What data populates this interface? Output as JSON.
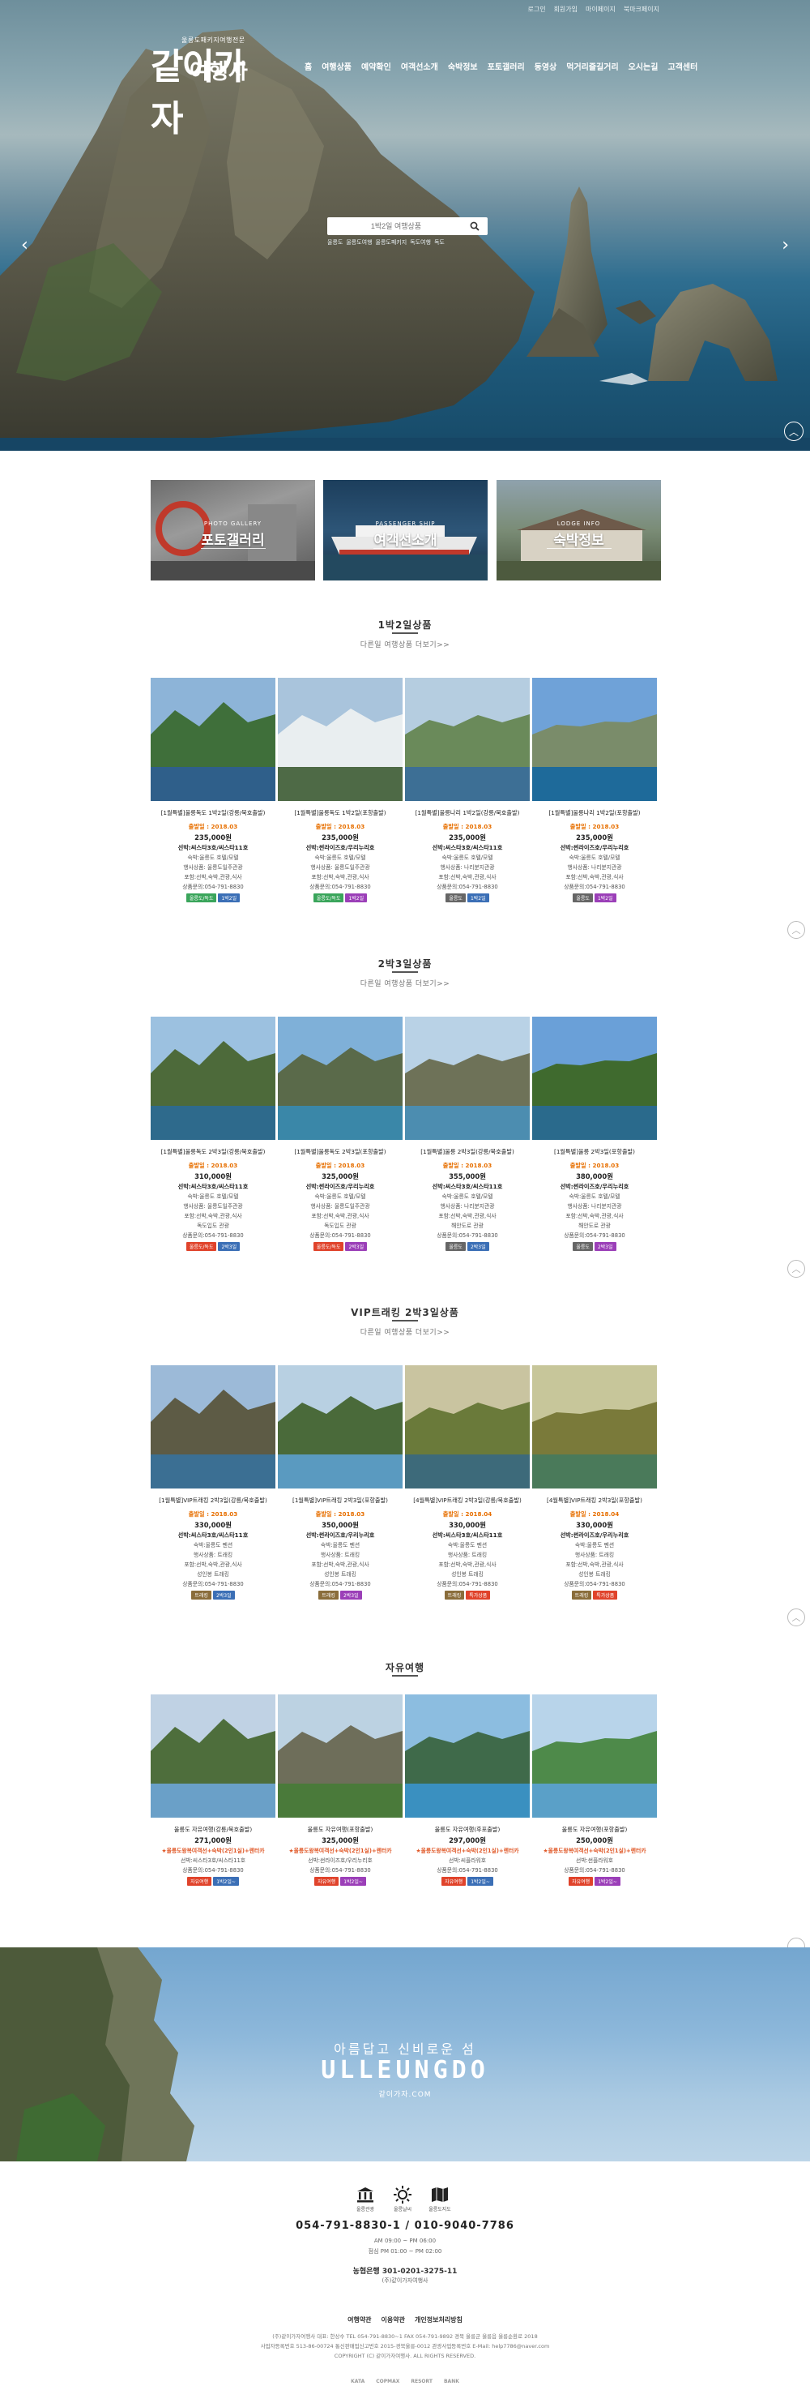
{
  "topbar": [
    "로그인",
    "회원가입",
    "마이페이지",
    "북마크페이지"
  ],
  "logo": {
    "sub": "울릉도패키지여행전문",
    "line1": "같이가자",
    "line2": "여행사"
  },
  "nav": [
    "홈",
    "여행상품",
    "예약확인",
    "여객선소개",
    "숙박정보",
    "포토갤러리",
    "동영상",
    "먹거리즐길거리",
    "오시는길",
    "고객센터"
  ],
  "search": {
    "placeholder": "1박2일 여행상품",
    "keywords": [
      "울릉도",
      "울릉도여행",
      "울릉도패키지",
      "독도여행",
      "독도"
    ]
  },
  "quick": [
    {
      "small": "PHOTO GALLERY",
      "label": "포토갤러리"
    },
    {
      "small": "PASSENGER SHIP",
      "label": "여객선소개"
    },
    {
      "small": "LODGE INFO",
      "label": "숙박정보"
    }
  ],
  "sections": [
    {
      "title": "1박2일상품",
      "more": "다른일 여행상품 더보기>>",
      "cards": [
        {
          "title": "[1월특별]울릉독도 1박2일(강릉/묵호출발)",
          "date": "출발일 : 2018.03",
          "price": "235,000원",
          "lines": [
            "선박:씨스타3호/씨스타11호",
            "숙박:울릉도 호텔/모텔",
            "행사상품: 울릉도일주관광",
            "포함:선박,숙박,관광,식사",
            "상품문의:054-791-8830"
          ],
          "tags": [
            {
              "t": "울릉도/독도",
              "c": "#3aa55b"
            },
            {
              "t": "1박2일",
              "c": "#3b6fb6"
            }
          ]
        },
        {
          "title": "[1월특별]울릉독도 1박2일(포항출발)",
          "date": "출발일 : 2018.03",
          "price": "235,000원",
          "lines": [
            "선박:썬라이즈호/우리누리호",
            "숙박:울릉도 호텔/모텔",
            "행사상품: 울릉도일주관광",
            "포함:선박,숙박,관광,식사",
            "상품문의:054-791-8830"
          ],
          "tags": [
            {
              "t": "울릉도/독도",
              "c": "#3aa55b"
            },
            {
              "t": "1박2일",
              "c": "#9b3fb8"
            }
          ]
        },
        {
          "title": "[1월특별]울릉나리 1박2일(강릉/묵호출발)",
          "date": "출발일 : 2018.03",
          "price": "235,000원",
          "lines": [
            "선박:씨스타3호/씨스타11호",
            "숙박:울릉도 호텔/모텔",
            "행사상품: 나리분지관광",
            "포함:선박,숙박,관광,식사",
            "상품문의:054-791-8830"
          ],
          "tags": [
            {
              "t": "울릉도",
              "c": "#666666"
            },
            {
              "t": "1박2일",
              "c": "#3b6fb6"
            }
          ]
        },
        {
          "title": "[1월특별]울릉나리 1박2일(포항출발)",
          "date": "출발일 : 2018.03",
          "price": "235,000원",
          "lines": [
            "선박:썬라이즈호/우리누리호",
            "숙박:울릉도 호텔/모텔",
            "행사상품: 나리분지관광",
            "포함:선박,숙박,관광,식사",
            "상품문의:054-791-8830"
          ],
          "tags": [
            {
              "t": "울릉도",
              "c": "#666666"
            },
            {
              "t": "1박2일",
              "c": "#9b3fb8"
            }
          ]
        }
      ]
    },
    {
      "title": "2박3일상품",
      "more": "다른일 여행상품 더보기>>",
      "cards": [
        {
          "title": "[1월특별]울릉독도 2박3일(강릉/묵호출발)",
          "date": "출발일 : 2018.03",
          "price": "310,000원",
          "lines": [
            "선박:씨스타3호/씨스타11호",
            "숙박:울릉도 호텔/모텔",
            "행사상품: 울릉도일주관광",
            "포함:선박,숙박,관광,식사",
            "독도입도 관광",
            "상품문의:054-791-8830"
          ],
          "tags": [
            {
              "t": "울릉도/독도",
              "c": "#e0432b"
            },
            {
              "t": "2박3일",
              "c": "#3b6fb6"
            }
          ]
        },
        {
          "title": "[1월특별]울릉독도 2박3일(포항출발)",
          "date": "출발일 : 2018.03",
          "price": "325,000원",
          "lines": [
            "선박:썬라이즈호/우리누리호",
            "숙박:울릉도 호텔/모텔",
            "행사상품: 울릉도일주관광",
            "포함:선박,숙박,관광,식사",
            "독도입도 관광",
            "상품문의:054-791-8830"
          ],
          "tags": [
            {
              "t": "울릉도/독도",
              "c": "#e0432b"
            },
            {
              "t": "2박3일",
              "c": "#9b3fb8"
            }
          ]
        },
        {
          "title": "[1월특별]울릉 2박3일(강릉/묵호출발)",
          "date": "출발일 : 2018.03",
          "price": "355,000원",
          "lines": [
            "선박:씨스타3호/씨스타11호",
            "숙박:울릉도 호텔/모텔",
            "행사상품: 나리분지관광",
            "포함:선박,숙박,관광,식사",
            "해안도로 관광",
            "상품문의:054-791-8830"
          ],
          "tags": [
            {
              "t": "울릉도",
              "c": "#666666"
            },
            {
              "t": "2박3일",
              "c": "#3b6fb6"
            }
          ]
        },
        {
          "title": "[1월특별]울릉 2박3일(포항출발)",
          "date": "출발일 : 2018.03",
          "price": "380,000원",
          "lines": [
            "선박:썬라이즈호/우리누리호",
            "숙박:울릉도 호텔/모텔",
            "행사상품: 나리분지관광",
            "포함:선박,숙박,관광,식사",
            "해안도로 관광",
            "상품문의:054-791-8830"
          ],
          "tags": [
            {
              "t": "울릉도",
              "c": "#666666"
            },
            {
              "t": "2박3일",
              "c": "#9b3fb8"
            }
          ]
        }
      ]
    },
    {
      "title": "VIP트래킹 2박3일상품",
      "more": "다른일 여행상품 더보기>>",
      "cards": [
        {
          "title": "[1월특별]VIP트래킹 2박3일(강릉/묵호출발)",
          "date": "출발일 : 2018.03",
          "price": "330,000원",
          "lines": [
            "선박:씨스타3호/씨스타11호",
            "숙박:울릉도 펜션",
            "행사상품: 트래킹",
            "포함:선박,숙박,관광,식사",
            "성인봉 트래킹",
            "상품문의:054-791-8830"
          ],
          "tags": [
            {
              "t": "트래킹",
              "c": "#8a6d3b"
            },
            {
              "t": "2박3일",
              "c": "#3b6fb6"
            }
          ]
        },
        {
          "title": "[1월특별]VIP트래킹 2박3일(포항출발)",
          "date": "출발일 : 2018.03",
          "price": "350,000원",
          "lines": [
            "선박:썬라이즈호/우리누리호",
            "숙박:울릉도 펜션",
            "행사상품: 트래킹",
            "포함:선박,숙박,관광,식사",
            "성인봉 트래킹",
            "상품문의:054-791-8830"
          ],
          "tags": [
            {
              "t": "트래킹",
              "c": "#8a6d3b"
            },
            {
              "t": "2박3일",
              "c": "#9b3fb8"
            }
          ]
        },
        {
          "title": "[4월특별]VIP트래킹 2박3일(강릉/묵호출발)",
          "date": "출발일 : 2018.04",
          "price": "330,000원",
          "lines": [
            "선박:씨스타3호/씨스타11호",
            "숙박:울릉도 펜션",
            "행사상품: 트래킹",
            "포함:선박,숙박,관광,식사",
            "성인봉 트래킹",
            "상품문의:054-791-8830"
          ],
          "tags": [
            {
              "t": "트래킹",
              "c": "#8a6d3b"
            },
            {
              "t": "특가상품",
              "c": "#e0432b"
            }
          ]
        },
        {
          "title": "[4월특별]VIP트래킹 2박3일(포항출발)",
          "date": "출발일 : 2018.04",
          "price": "330,000원",
          "lines": [
            "선박:썬라이즈호/우리누리호",
            "숙박:울릉도 펜션",
            "행사상품: 트래킹",
            "포함:선박,숙박,관광,식사",
            "성인봉 트래킹",
            "상품문의:054-791-8830"
          ],
          "tags": [
            {
              "t": "트래킹",
              "c": "#8a6d3b"
            },
            {
              "t": "특가상품",
              "c": "#e0432b"
            }
          ]
        }
      ]
    },
    {
      "title": "자유여행",
      "more": "",
      "cards": [
        {
          "title": "울릉도 자유여행(강릉/묵호출발)",
          "date": "",
          "price": "271,000원",
          "lines": [
            "★울릉도왕복여객선+숙박(2인1실)+렌터카",
            "선박:씨스타3호/씨스타11호",
            "상품문의:054-791-8830"
          ],
          "tags": [
            {
              "t": "자유여행",
              "c": "#e0432b"
            },
            {
              "t": "1박2일~",
              "c": "#3b6fb6"
            }
          ]
        },
        {
          "title": "울릉도 자유여행(포항출발)",
          "date": "",
          "price": "325,000원",
          "lines": [
            "★울릉도왕복여객선+숙박(2인1실)+렌터카",
            "선박:썬라이즈호/우리누리호",
            "상품문의:054-791-8830"
          ],
          "tags": [
            {
              "t": "자유여행",
              "c": "#e0432b"
            },
            {
              "t": "1박2일~",
              "c": "#9b3fb8"
            }
          ]
        },
        {
          "title": "울릉도 자유여행(후포출발)",
          "date": "",
          "price": "297,000원",
          "lines": [
            "★울릉도왕복여객선+숙박(2인1실)+렌터카",
            "선박:씨플라워호",
            "상품문의:054-791-8830"
          ],
          "tags": [
            {
              "t": "자유여행",
              "c": "#e0432b"
            },
            {
              "t": "1박2일~",
              "c": "#3b6fb6"
            }
          ]
        },
        {
          "title": "울릉도 자유여행(포항출발)",
          "date": "",
          "price": "250,000원",
          "lines": [
            "★울릉도왕복여객선+숙박(2인1실)+렌터카",
            "선박:썬플라워호",
            "상품문의:054-791-8830"
          ],
          "tags": [
            {
              "t": "자유여행",
              "c": "#e0432b"
            },
            {
              "t": "1박2일~",
              "c": "#9b3fb8"
            }
          ]
        }
      ]
    }
  ],
  "banner": {
    "sub": "아름답고 신비로운 섬",
    "main": "ULLEUNGDO",
    "domain": "같이가자.COM"
  },
  "footer": {
    "icons": [
      "울릉관광",
      "울릉날씨",
      "울릉도지도"
    ],
    "phone": "054-791-8830-1 / 010-9040-7786",
    "hours1": "AM 09:00 ~ PM 06:00",
    "hours2": "점심 PM 01:00 ~ PM 02:00",
    "bank": "농협은행 301-0201-3275-11",
    "bank_owner": "(주)같이가자여행사",
    "links": [
      "여행약관",
      "이용약관",
      "개인정보처리방침"
    ],
    "addr1": "(주)같이가자여행사   대표: 한상수   TEL 054-791-8830~1   FAX 054-791-9892   경북 울릉군 울릉읍 울릉순환로 2018",
    "addr2": "사업자등록번호 513-86-00724   통신판매업신고번호 2015-경북울릉-0012   관광사업등록번호 E-Mail: help7786@naver.com",
    "copy": "COPYRIGHT (C) 같이가자여행사. ALL RIGHTS RESERVED.",
    "logos": [
      "KATA",
      "COPMAX",
      "RESORT",
      "BANK"
    ]
  }
}
